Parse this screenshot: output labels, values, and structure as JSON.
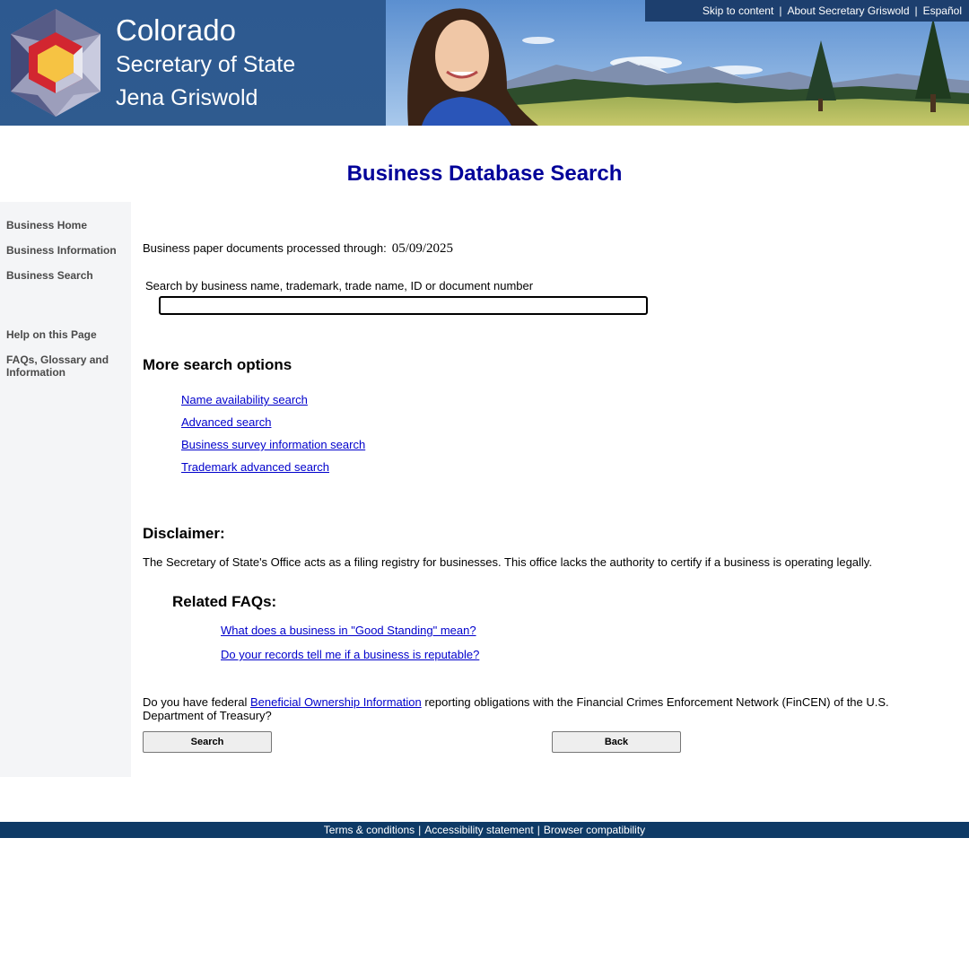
{
  "header": {
    "brand_line1": "Colorado",
    "brand_line2": "Secretary of State",
    "brand_line3": "Jena Griswold",
    "top_links": [
      "Skip to content",
      "About Secretary Griswold",
      "Español"
    ]
  },
  "page_title": "Business Database Search",
  "sidebar": {
    "items": [
      {
        "label": "Business Home"
      },
      {
        "label": "Business Information"
      },
      {
        "label": "Business Search"
      },
      {
        "label": "Help on this Page"
      },
      {
        "label": "FAQs, Glossary and Information"
      }
    ]
  },
  "main": {
    "processed_label": "Business paper documents processed through:",
    "processed_date": "05/09/2025",
    "search_label": "Search by business name, trademark, trade name, ID or document number",
    "search_value": "",
    "more_heading": "More search options",
    "options": [
      "Name availability search",
      "Advanced search",
      "Business survey information search",
      "Trademark advanced search"
    ],
    "disclaimer_heading": "Disclaimer:",
    "disclaimer_text": "The Secretary of State's Office acts as a filing registry for businesses. This office lacks the authority to certify if a business is operating legally.",
    "faq_heading": "Related FAQs:",
    "faqs": [
      "What does a business in \"Good Standing\" mean?",
      "Do your records tell me if a business is reputable?"
    ],
    "boi_prefix": "Do you have federal ",
    "boi_link": "Beneficial Ownership Information",
    "boi_suffix": " reporting obligations with the Financial Crimes Enforcement Network (FinCEN) of the U.S. Department of Treasury?",
    "search_button": "Search",
    "back_button": "Back"
  },
  "footer": {
    "links": [
      "Terms & conditions",
      "Accessibility statement",
      "Browser compatibility"
    ]
  },
  "colors": {
    "title": "#000099",
    "link": "#0000cc",
    "banner": "#2f5a8e",
    "footer": "#0e3a66",
    "sidebar": "#f4f5f7"
  }
}
